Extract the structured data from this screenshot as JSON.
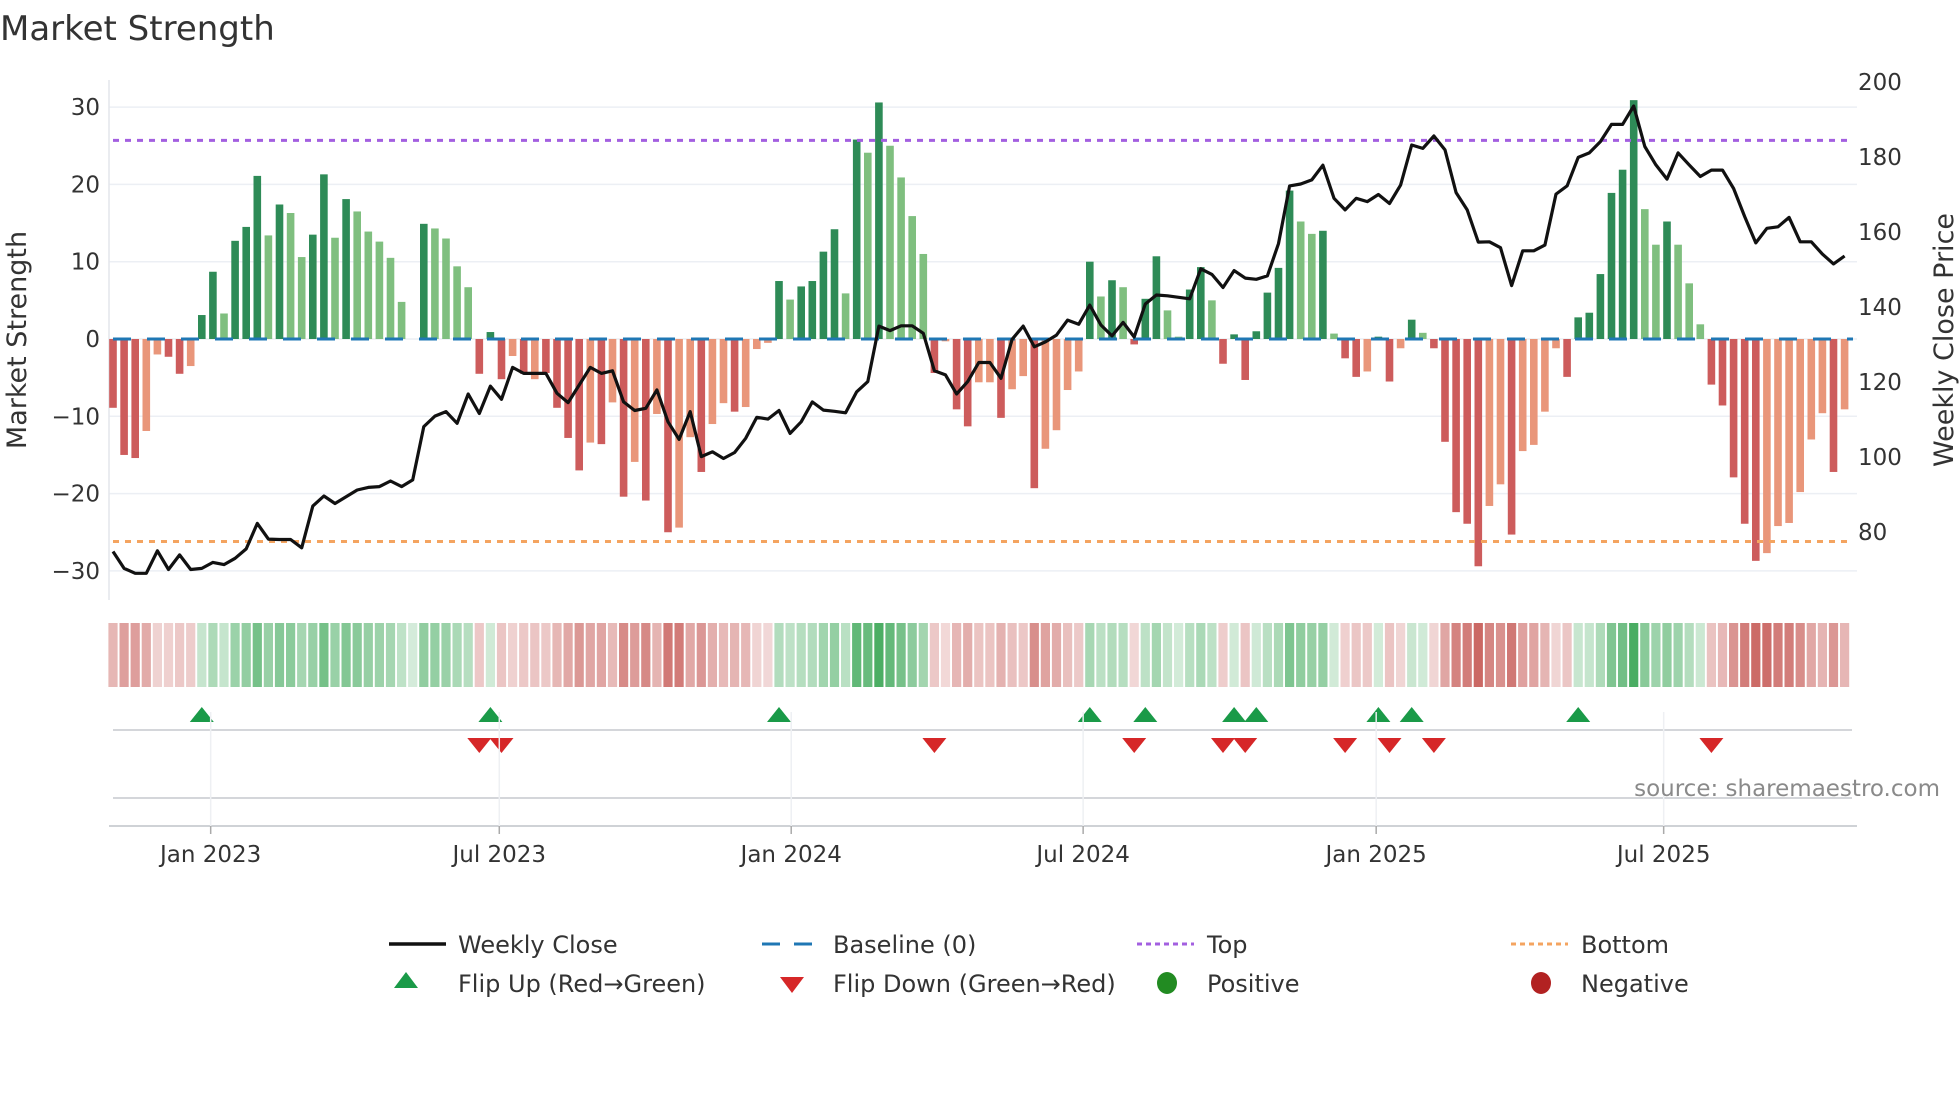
{
  "chart_data": {
    "type": "bar",
    "title": "Market Strength",
    "ylabel": "Market Strength",
    "y2label": "Weekly Close Price",
    "ylim": [
      -33,
      33
    ],
    "y2lim": [
      66.7,
      212
    ],
    "yticks": [
      30,
      20,
      10,
      0,
      -10,
      -20,
      -30
    ],
    "yticklabels": [
      "30",
      "20",
      "10",
      "0",
      "−10",
      "−20",
      "−30"
    ],
    "y2ticks": [
      200,
      180,
      160,
      140,
      120,
      100,
      80
    ],
    "y2ticklabels": [
      "200",
      "180",
      "160",
      "140",
      "120",
      "100",
      "80"
    ],
    "xticks": [
      {
        "label": "Jan 2023",
        "week": 8.8
      },
      {
        "label": "Jul 2023",
        "week": 34.8
      },
      {
        "label": "Jan 2024",
        "week": 61.1
      },
      {
        "label": "Jul 2024",
        "week": 87.4
      },
      {
        "label": "Jan 2025",
        "week": 113.8
      },
      {
        "label": "Jul 2025",
        "week": 139.7
      }
    ],
    "top_level": 25.7,
    "bottom_level": -26.2,
    "baseline": 0,
    "strength": [
      -8.9,
      -15.0,
      -15.4,
      -11.9,
      -2.0,
      -2.3,
      -4.5,
      -3.5,
      3.1,
      8.7,
      3.3,
      12.7,
      14.5,
      21.1,
      13.4,
      17.4,
      16.3,
      10.6,
      13.5,
      21.3,
      13.1,
      18.1,
      16.5,
      13.9,
      12.6,
      10.5,
      4.8,
      0.0,
      14.9,
      14.3,
      13.0,
      9.4,
      6.7,
      -4.5,
      0.9,
      -5.2,
      -2.2,
      -4.5,
      -5.2,
      -4.4,
      -8.9,
      -12.8,
      -17.0,
      -13.4,
      -13.6,
      -8.2,
      -20.4,
      -15.9,
      -20.9,
      -9.7,
      -25.0,
      -24.4,
      -12.7,
      -17.2,
      -11.0,
      -8.3,
      -9.4,
      -8.8,
      -1.3,
      -0.5,
      7.5,
      5.1,
      6.8,
      7.5,
      11.3,
      14.2,
      5.9,
      25.8,
      24.1,
      30.6,
      25.0,
      20.9,
      15.9,
      11.0,
      -4.4,
      -0.3,
      -9.1,
      -11.3,
      -5.6,
      -5.6,
      -10.2,
      -6.5,
      -4.8,
      -19.3,
      -14.2,
      -11.8,
      -6.6,
      -4.2,
      10.0,
      5.5,
      7.6,
      6.7,
      -0.7,
      5.2,
      10.7,
      3.7,
      0.3,
      6.4,
      9.3,
      5.0,
      -3.2,
      0.6,
      -5.3,
      1.0,
      6.0,
      9.2,
      19.2,
      15.2,
      13.6,
      14.0,
      0.7,
      -2.5,
      -4.9,
      -4.2,
      0.3,
      -5.5,
      -1.2,
      2.5,
      0.8,
      -1.2,
      -13.3,
      -22.4,
      -23.9,
      -29.4,
      -21.6,
      -18.8,
      -25.3,
      -14.5,
      -13.7,
      -9.4,
      -1.2,
      -4.9,
      2.8,
      3.4,
      8.4,
      18.9,
      21.9,
      30.9,
      16.8,
      12.2,
      15.2,
      12.2,
      7.2,
      1.9,
      -5.9,
      -8.6,
      -17.9,
      -23.9,
      -28.7,
      -27.7,
      -24.2,
      -23.8,
      -19.8,
      -13.0,
      -9.6,
      -17.2,
      -9.1
    ],
    "strong": "DDDLLDDLDDLDDDLDLLDDLDLLLLLLDLLLLDDDLDLDDDDLDLDLDLDLLDLLDLLLDLDDDDLDLDLLLLDLDDLLDLLDLLLLDLDLDDDLLDDLDDDDDDDLLDLDDLDDLDLDDDDDLLDLLLLDDDDDDDLLDLLLDDDDDLLLLLLDL",
    "weekly_close": [
      74.8,
      70.3,
      69,
      69,
      75,
      70,
      73.9,
      70,
      70.3,
      71.9,
      71.3,
      73,
      75.5,
      82.3,
      78.1,
      78,
      78,
      75.8,
      86.9,
      89.6,
      87.6,
      89.4,
      91.2,
      91.9,
      92.1,
      93.6,
      92.1,
      93.9,
      108.1,
      110.9,
      112.1,
      109,
      116.8,
      111.6,
      118.9,
      115.4,
      123.9,
      122.3,
      122.3,
      122.3,
      117,
      114.5,
      119.2,
      123.9,
      122.3,
      123,
      114.7,
      112.4,
      113,
      117.9,
      109.4,
      104.7,
      112.1,
      100.1,
      101.4,
      99.6,
      101.2,
      105,
      110.6,
      110.1,
      112.4,
      106.3,
      109.4,
      114.7,
      112.5,
      112.2,
      111.8,
      117.4,
      120.1,
      134.9,
      133.7,
      135,
      135,
      133,
      123,
      121.9,
      116.8,
      120.1,
      125.2,
      125.2,
      121,
      131.4,
      134.9,
      129.4,
      130.7,
      132.5,
      136.5,
      135.4,
      140.5,
      135.2,
      132.3,
      135.9,
      132,
      140.8,
      143.2,
      143,
      142.6,
      142.2,
      150.2,
      148.7,
      145.2,
      149.7,
      147.7,
      147.4,
      148.3,
      156.9,
      172.3,
      172.8,
      173.9,
      177.8,
      169,
      165.9,
      169,
      168.1,
      170,
      167.6,
      172.5,
      183.2,
      182.3,
      185.6,
      181.9,
      170.5,
      165.9,
      157.3,
      157.4,
      155.8,
      145.7,
      155,
      155,
      156.5,
      170.1,
      172.3,
      179.9,
      181.1,
      184.1,
      188.7,
      188.7,
      193.6,
      182.8,
      177.9,
      174.1,
      181.1,
      177.9,
      174.8,
      176.5,
      176.5,
      171.6,
      164.1,
      157.1,
      161,
      161.4,
      163.9,
      157.4,
      157.4,
      154.1,
      151.5,
      153.6
    ],
    "flip_up_weeks": [
      9,
      35,
      61,
      89,
      94,
      102,
      104,
      115,
      118,
      133
    ],
    "flip_down_weeks": [
      34,
      36,
      75,
      93,
      101,
      103,
      112,
      116,
      120,
      145
    ],
    "legend": {
      "position": "bottom",
      "items": [
        {
          "label": "Weekly Close",
          "icon": "solid-line"
        },
        {
          "label": "Baseline (0)",
          "icon": "dashed-line"
        },
        {
          "label": "Top",
          "icon": "dotted-line"
        },
        {
          "label": "Bottom",
          "icon": "dotted-line"
        },
        {
          "label": "Flip Up (Red→Green)",
          "icon": "triangle-up"
        },
        {
          "label": "Flip Down (Green→Red)",
          "icon": "triangle-down"
        },
        {
          "label": "Positive",
          "icon": "circle"
        },
        {
          "label": "Negative",
          "icon": "circle"
        }
      ]
    },
    "source": "source: sharemaestro.com"
  },
  "colors": {
    "pos_strong": "#2e8b57",
    "pos_weak": "#7fbf7f",
    "neg_strong": "#cd5c5c",
    "neg_weak": "#e9967a",
    "close": "#111111",
    "baseline": "#1f77b4",
    "top": "#a35fe0",
    "bottom": "#f4a460",
    "flip_up": "#1a9a48",
    "flip_down": "#d62728",
    "positive": "#228b22",
    "negative": "#b22222",
    "grid": "#eceff4"
  }
}
